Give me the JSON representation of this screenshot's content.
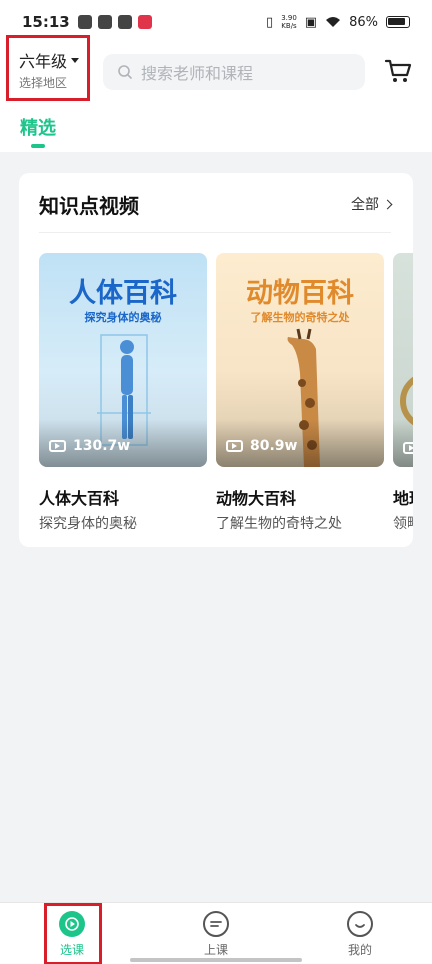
{
  "status_bar": {
    "time": "15:13",
    "net_speed_value": "3.90",
    "net_speed_unit": "KB/s",
    "battery": "86%"
  },
  "header": {
    "grade": "六年级",
    "region": "选择地区",
    "search_placeholder": "搜索老师和课程"
  },
  "tabs": [
    {
      "label": "精选",
      "active": true
    }
  ],
  "knowledge_section": {
    "title": "知识点视频",
    "see_all": "全部",
    "videos": [
      {
        "thumb_title": "人体百科",
        "thumb_subtitle": "探究身体的奥秘",
        "views": "130.7w",
        "name": "人体大百科",
        "desc": "探究身体的奥秘"
      },
      {
        "thumb_title": "动物百科",
        "thumb_subtitle": "了解生物的奇特之处",
        "views": "80.9w",
        "name": "动物大百科",
        "desc": "了解生物的奇特之处"
      },
      {
        "thumb_title": "",
        "thumb_subtitle": "",
        "views": "",
        "name": "地理",
        "desc": "领略"
      }
    ]
  },
  "bottom_nav": [
    {
      "label": "选课",
      "icon": "play-circle-icon",
      "active": true
    },
    {
      "label": "上课",
      "icon": "chat-lines-icon",
      "active": false
    },
    {
      "label": "我的",
      "icon": "smiley-icon",
      "active": false
    }
  ],
  "colors": {
    "accent": "#1ec58b",
    "highlight": "#d81e2a",
    "body_bg": "#f2f3f5"
  }
}
